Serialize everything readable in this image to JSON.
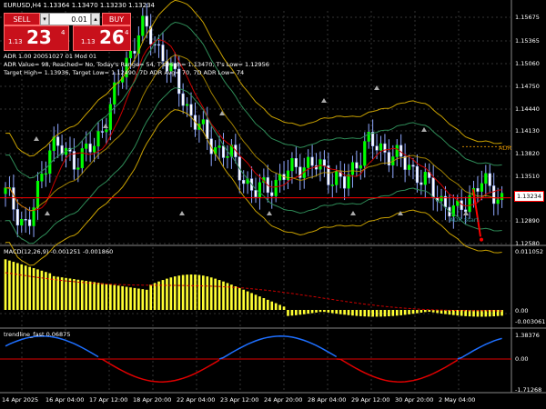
{
  "title": "EURUSD,H4  1.13364 1.13470 1.13230 1.13234",
  "trade_panel": {
    "sell_label": "SELL",
    "buy_label": "BUY",
    "lot_value": "0.01",
    "sell_prefix": "1.13",
    "sell_big": "23",
    "sell_sup": "4",
    "buy_prefix": "1.13",
    "buy_big": "26",
    "buy_sup": "4"
  },
  "info_lines": [
    "ADR 1.00 20051027 01 Mod 01",
    "ADR Value= 98, Reached= No, Today's Range= 54, T's High= 1.13470, T's Low= 1.12956",
    "Target High= 1.13936, Target Low= 1.12490, 7D ADR Avg= 70, 7D ADR Low= 74"
  ],
  "main_price_ticks": [
    "1.15675",
    "1.15365",
    "1.15060",
    "1.14750",
    "1.14440",
    "1.14130",
    "1.13820",
    "1.13510",
    "1.13234",
    "1.12890",
    "1.12580"
  ],
  "current_price": "1.13234",
  "adr_label": "ADR",
  "adr_start_label": "ADR Start",
  "macd": {
    "label": "MACD(12,26,9) -0.001251 -0.001860",
    "ticks": [
      "0.011052",
      "0.00",
      "-0.003061"
    ]
  },
  "trendline": {
    "label": "trendline_fast 0.06875",
    "ticks": [
      "1.38376",
      "0.00",
      "-1.71268"
    ]
  },
  "time_ticks": [
    "14 Apr 2025",
    "16 Apr 04:00",
    "17 Apr 12:00",
    "18 Apr 20:00",
    "22 Apr 04:00",
    "23 Apr 12:00",
    "24 Apr 20:00",
    "28 Apr 04:00",
    "29 Apr 12:00",
    "30 Apr 20:00",
    "2 May 04:00"
  ],
  "colors": {
    "background": "#000000",
    "bull_candle": "#00ff00",
    "bear_candle": "#ffffff",
    "wick": "#8fa8ff",
    "band_outer": "#c8a000",
    "band_inner": "#2e8b57",
    "ma_red": "#cc0000",
    "macd_bar": "#ffff33",
    "macd_signal": "#cc0000",
    "trend_blue": "#1e6fff",
    "trend_red": "#e00000",
    "price_line": "#ff0000"
  },
  "chart_data": {
    "type": "line",
    "title": "EURUSD,H4",
    "x": [
      "14 Apr 2025",
      "16 Apr 04:00",
      "17 Apr 12:00",
      "18 Apr 20:00",
      "22 Apr 04:00",
      "23 Apr 12:00",
      "24 Apr 20:00",
      "28 Apr 04:00",
      "29 Apr 12:00",
      "30 Apr 20:00",
      "2 May 04:00"
    ],
    "series": [
      {
        "values": [
          1.133,
          1.1385,
          1.137,
          1.152,
          1.1445,
          1.133,
          1.137,
          1.138,
          1.1395,
          1.1325,
          1.1323
        ]
      }
    ],
    "ylim": [
      1.1258,
      1.158
    ]
  }
}
